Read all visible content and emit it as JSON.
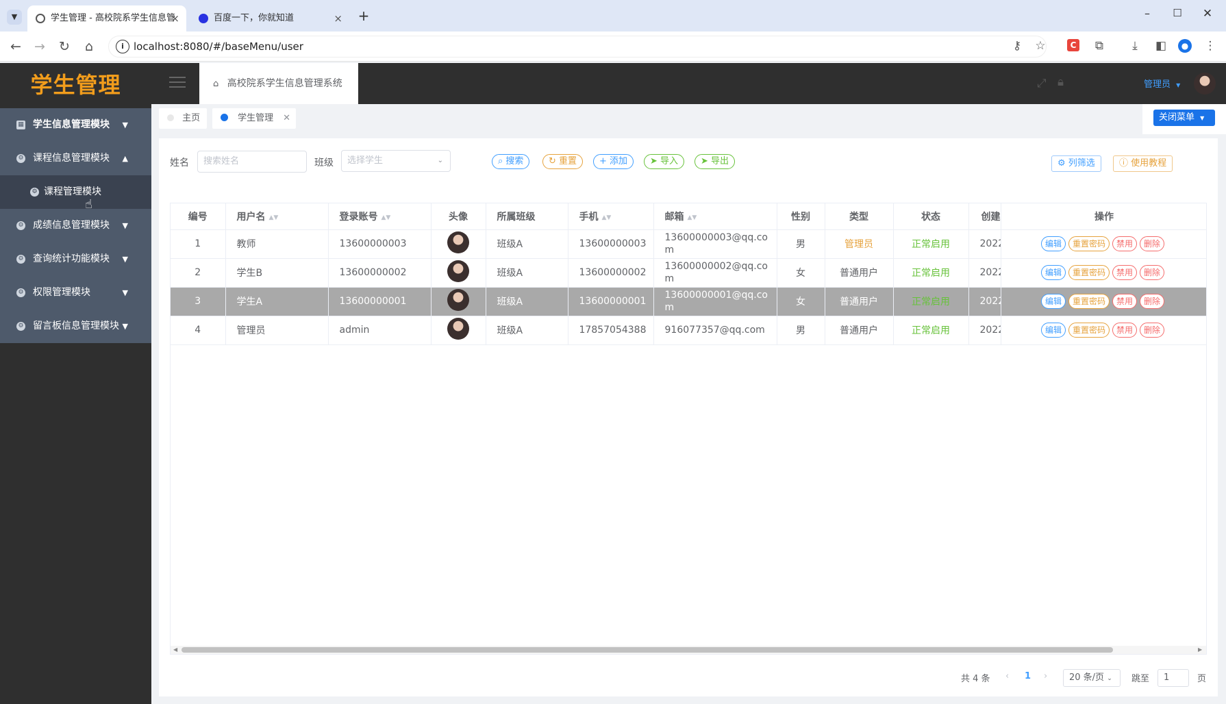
{
  "browser": {
    "tabs": [
      {
        "title": "学生管理 - 高校院系学生信息管"
      },
      {
        "title": "百度一下，你就知道"
      }
    ],
    "url": "localhost:8080/#/baseMenu/user",
    "new_tab": "+",
    "tab_close": "×"
  },
  "app": {
    "logo": "学生管理",
    "breadcrumb": "高校院系学生信息管理系统",
    "user": "管理员",
    "close_menu": "关闭菜单"
  },
  "sidebar": {
    "items": [
      {
        "label": "学生信息管理模块",
        "expanded": false
      },
      {
        "label": "课程信息管理模块",
        "expanded": true
      },
      {
        "label": "成绩信息管理模块",
        "expanded": false
      },
      {
        "label": "查询统计功能模块",
        "expanded": false
      },
      {
        "label": "权限管理模块",
        "expanded": false
      },
      {
        "label": "留言板信息管理模块",
        "expanded": false
      }
    ],
    "submenu": "课程管理模块"
  },
  "tags": {
    "home": "主页",
    "current": "学生管理"
  },
  "filters": {
    "name_label": "姓名",
    "name_placeholder": "搜索姓名",
    "class_label": "班级",
    "class_placeholder": "选择学生",
    "search": "搜索",
    "reset": "重置",
    "add": "添加",
    "import": "导入",
    "export": "导出",
    "column_filter": "列筛选",
    "tutorial": "使用教程"
  },
  "table": {
    "headers": [
      "编号",
      "用户名",
      "登录账号",
      "头像",
      "所属班级",
      "手机",
      "邮箱",
      "性别",
      "类型",
      "状态",
      "创建",
      "操作"
    ],
    "rows": [
      {
        "id": "1",
        "username": "教师",
        "account": "13600000003",
        "class": "班级A",
        "phone": "13600000003",
        "email": "13600000003@qq.com",
        "gender": "男",
        "type": "管理员",
        "status": "正常启用",
        "created": "2022"
      },
      {
        "id": "2",
        "username": "学生B",
        "account": "13600000002",
        "class": "班级A",
        "phone": "13600000002",
        "email": "13600000002@qq.com",
        "gender": "女",
        "type": "普通用户",
        "status": "正常启用",
        "created": "2022"
      },
      {
        "id": "3",
        "username": "学生A",
        "account": "13600000001",
        "class": "班级A",
        "phone": "13600000001",
        "email": "13600000001@qq.com",
        "gender": "女",
        "type": "普通用户",
        "status": "正常启用",
        "created": "2022"
      },
      {
        "id": "4",
        "username": "管理员",
        "account": "admin",
        "class": "班级A",
        "phone": "17857054388",
        "email": "916077357@qq.com",
        "gender": "男",
        "type": "普通用户",
        "status": "正常启用",
        "created": "2022"
      }
    ],
    "actions": {
      "edit": "编辑",
      "reset_pwd": "重置密码",
      "disable": "禁用",
      "delete": "删除"
    }
  },
  "pagination": {
    "total": "共 4 条",
    "page": "1",
    "page_size": "20 条/页",
    "goto": "跳至",
    "goto_value": "1",
    "page_unit": "页"
  },
  "colors": {
    "accent": "#1a73e8",
    "logo": "#f29d1c",
    "sidebar": "#4e5a6b"
  }
}
